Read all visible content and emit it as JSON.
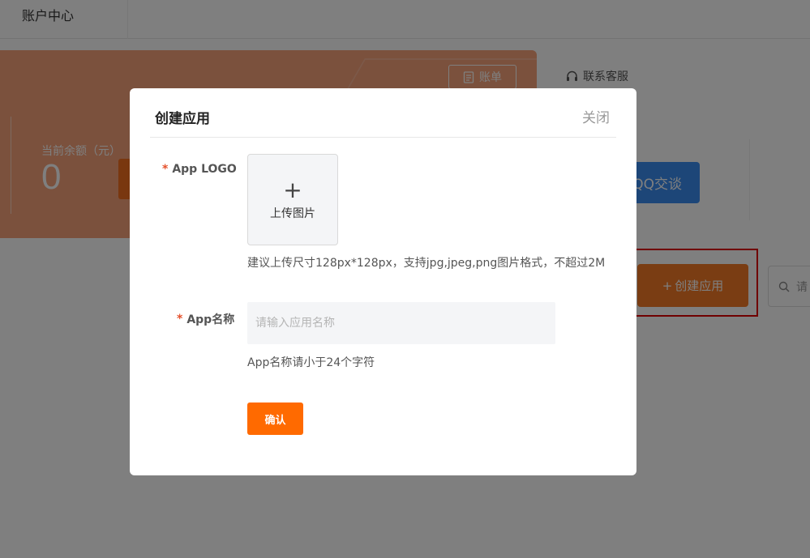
{
  "header": {
    "title": "账户中心"
  },
  "balance": {
    "label": "当前余额（元）",
    "value": "0",
    "bill_label": "账单"
  },
  "service": {
    "title": "联系客服",
    "qq_label": "QQ交谈"
  },
  "toolbar": {
    "create_label": "创建应用",
    "search_placeholder": "请"
  },
  "modal": {
    "title": "创建应用",
    "close_label": "关闭",
    "logo": {
      "required_mark": "*",
      "label": "App LOGO",
      "upload_plus": "+",
      "upload_label": "上传图片",
      "hint": "建议上传尺寸128px*128px，支持jpg,jpeg,png图片格式，不超过2M"
    },
    "name": {
      "required_mark": "*",
      "label": "App名称",
      "placeholder": "请输入应用名称",
      "value": "",
      "hint": "App名称请小于24个字符"
    },
    "confirm_label": "确认"
  },
  "colors": {
    "brand_orange": "#ff6a00",
    "balance_card": "#f7a27a",
    "qq_blue": "#3a8cf0",
    "highlight_red": "#e00000"
  }
}
